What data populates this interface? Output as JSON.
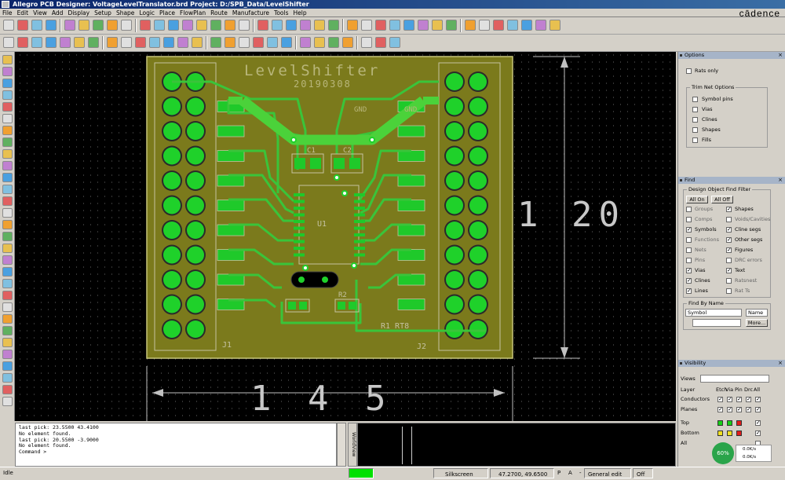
{
  "window": {
    "title": "Allegro PCB Designer: VoltageLevelTranslator.brd  Project: D:/SPB_Data/LevelShifter",
    "brand": "cādence"
  },
  "menu": [
    "File",
    "Edit",
    "View",
    "Add",
    "Display",
    "Setup",
    "Shape",
    "Logic",
    "Place",
    "FlowPlan",
    "Route",
    "Manufacture",
    "Tools",
    "Help"
  ],
  "toolbar_icons": [
    "new-icon",
    "open-icon",
    "save-icon",
    "undo-icon",
    "redo-icon",
    "move-icon",
    "copy-icon",
    "delete-icon",
    "pick-icon",
    "zoom-in-icon",
    "zoom-out-icon",
    "zoom-fit-icon",
    "refresh-icon",
    "grid-icon",
    "layers-icon",
    "help-icon"
  ],
  "board": {
    "title_text": "LevelShifter",
    "date_text": "20190308",
    "ref_j1": "J1",
    "ref_j2": "J2",
    "ref_u1": "U1",
    "ref_c1": "C1",
    "ref_c2": "C2",
    "ref_r2": "R2",
    "ref_r1_rt8": "R1 RT8",
    "dim_width": "1 4 5",
    "dim_height": "1 20",
    "gnd_left": "GND",
    "gnd_right": "GND"
  },
  "command_console": {
    "lines": [
      "last pick:  23.5500 43.4100",
      "No element found.",
      "last pick:  20.5500 -3.9000",
      "No element found.",
      "Command >"
    ]
  },
  "options_panel": {
    "title": "Options",
    "rats_only_label": "Rats only",
    "ratsnest_group": "Trim Net Options",
    "items": [
      "Symbol pins",
      "Vias",
      "Clines",
      "Shapes",
      "Fills"
    ]
  },
  "find_panel": {
    "title": "Find",
    "group_label": "Design Object Find Filter",
    "all_on": "All On",
    "all_off": "All Off",
    "left_items": [
      {
        "label": "Groups",
        "checked": false
      },
      {
        "label": "Comps",
        "checked": false
      },
      {
        "label": "Symbols",
        "checked": true
      },
      {
        "label": "Functions",
        "checked": false
      },
      {
        "label": "Nets",
        "checked": false
      },
      {
        "label": "Pins",
        "checked": false
      },
      {
        "label": "Vias",
        "checked": true
      },
      {
        "label": "Clines",
        "checked": true
      },
      {
        "label": "Lines",
        "checked": true
      }
    ],
    "right_items": [
      {
        "label": "Shapes",
        "checked": true
      },
      {
        "label": "Voids/Cavities",
        "checked": false
      },
      {
        "label": "Cline segs",
        "checked": true
      },
      {
        "label": "Other segs",
        "checked": true
      },
      {
        "label": "Figures",
        "checked": true
      },
      {
        "label": "DRC errors",
        "checked": false
      },
      {
        "label": "Text",
        "checked": true
      },
      {
        "label": "Ratsnest",
        "checked": false
      },
      {
        "label": "Rat Ts",
        "checked": false
      }
    ],
    "find_by_name_label": "Find By Name",
    "find_by_name_value": "Symbol",
    "name_mode": "Name",
    "more_button": "More..."
  },
  "visibility_panel": {
    "title": "Visibility",
    "views_label": "Views",
    "layer_label": "Layer",
    "columns": [
      "Etch",
      "Via",
      "Pin",
      "Drc",
      "All"
    ],
    "rows": [
      {
        "label": "Conductors"
      },
      {
        "label": "Planes"
      }
    ],
    "layers": [
      {
        "label": "Top",
        "etch_color": "#16d016",
        "via_color": "#16d016",
        "pin_color": "#e21b1b"
      },
      {
        "label": "Bottom",
        "etch_color": "#f0e020",
        "via_color": "#f0e020",
        "pin_color": "#e21b1b"
      },
      {
        "label": "All"
      }
    ]
  },
  "status": {
    "mode": "Idle",
    "worldview_tab": "WorldView",
    "layer": "Silkscreen",
    "coords": "47.2700, 49.6500",
    "p_label": "P",
    "a_label": "A",
    "dash": "-",
    "mode_label": "General edit",
    "off": "Off",
    "zoom_pct": "60%",
    "net_up": "0.0K/s",
    "net_down": "0.0K/s"
  },
  "colors": {
    "board_fill": "#7b7a1c",
    "copper_top": "#1fd12a",
    "copper_trace": "#3ac43a",
    "silkscreen": "#c4c2a0",
    "background": "#000000"
  }
}
